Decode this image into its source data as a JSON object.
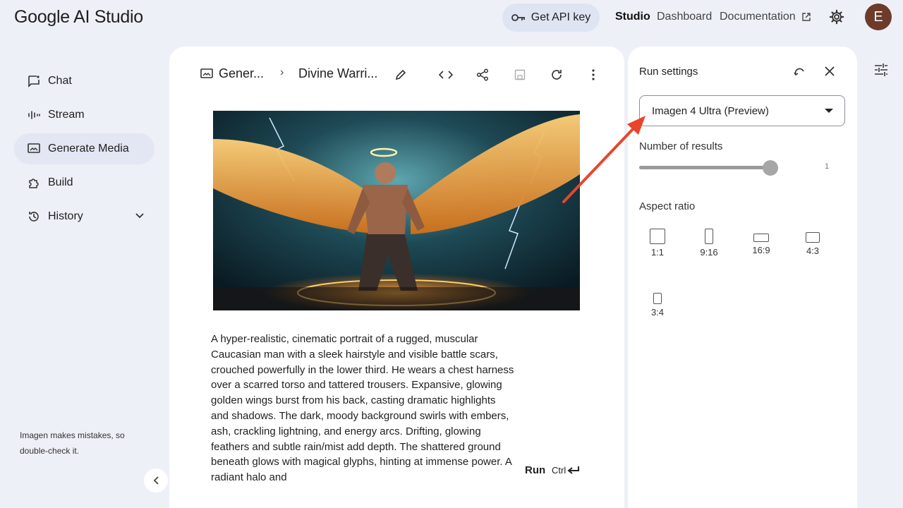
{
  "header": {
    "logo": "Google AI Studio",
    "api_key_label": "Get API key",
    "nav": [
      "Studio",
      "Dashboard",
      "Documentation"
    ],
    "avatar_initial": "E"
  },
  "sidebar": {
    "items": [
      {
        "label": "Chat",
        "icon": "chat-icon"
      },
      {
        "label": "Stream",
        "icon": "stream-icon"
      },
      {
        "label": "Generate Media",
        "icon": "media-icon",
        "selected": true
      },
      {
        "label": "Build",
        "icon": "build-icon"
      },
      {
        "label": "History",
        "icon": "history-icon"
      }
    ],
    "disclaimer": "Imagen makes mistakes, so double-check it."
  },
  "main": {
    "breadcrumb_1": "Gener...",
    "breadcrumb_sep": "›",
    "breadcrumb_2": "Divine Warri...",
    "prompt_text": "A hyper-realistic, cinematic portrait of a rugged, muscular Caucasian man with a sleek hairstyle and visible battle scars, crouched powerfully in the lower third. He wears a chest harness over a scarred torso and tattered trousers. Expansive, glowing golden wings burst from his back, casting dramatic highlights and shadows. The dark, moody background swirls with embers, ash, crackling lightning, and energy arcs. Drifting, glowing feathers and subtle rain/mist add depth. The shattered ground beneath glows with magical glyphs, hinting at immense power. A radiant halo and",
    "run_label": "Run",
    "shortcut_label": "Ctrl"
  },
  "settings": {
    "title": "Run settings",
    "model": "Imagen 4 Ultra (Preview)",
    "results_label": "Number of results",
    "results_value": "1",
    "results_fraction": 1.0,
    "aspect_label": "Aspect ratio",
    "ratios": [
      "1:1",
      "9:16",
      "16:9",
      "4:3",
      "3:4"
    ]
  },
  "colors": {
    "page_bg": "#eef0f7",
    "accent_arrow": "#e8452c",
    "selected_nav": "#e3e6f3",
    "api_button": "#dfe4f3"
  }
}
